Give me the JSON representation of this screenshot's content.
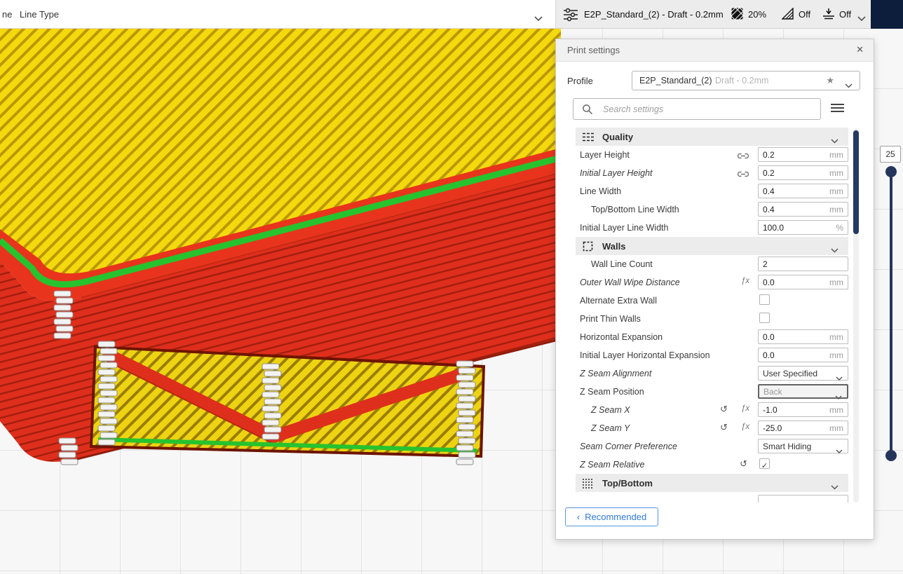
{
  "topbar": {
    "truncated_left_text": "ne",
    "color_scheme_dropdown": {
      "label": "Line Type"
    },
    "print_setup_summary": {
      "profile_text": "E2P_Standard_(2) - Draft - 0.2mm",
      "infill": "20%",
      "support": "Off",
      "adhesion": "Off"
    }
  },
  "print_settings_panel": {
    "title": "Print settings",
    "profile": {
      "label": "Profile",
      "name": "E2P_Standard_(2)",
      "variant": "Draft - 0.2mm"
    },
    "search_placeholder": "Search settings",
    "sections": {
      "quality": "Quality",
      "walls": "Walls",
      "top_bottom": "Top/Bottom"
    },
    "rows": [
      {
        "label": "Layer Height",
        "value": "0.2",
        "unit": "mm"
      },
      {
        "label": "Initial Layer Height",
        "value": "0.2",
        "unit": "mm"
      },
      {
        "label": "Line Width",
        "value": "0.4",
        "unit": "mm"
      },
      {
        "label": "Top/Bottom Line Width",
        "value": "0.4",
        "unit": "mm"
      },
      {
        "label": "Initial Layer Line Width",
        "value": "100.0",
        "unit": "%"
      },
      {
        "label": "Wall Line Count",
        "value": "2",
        "unit": ""
      },
      {
        "label": "Outer Wall Wipe Distance",
        "value": "0.0",
        "unit": "mm"
      },
      {
        "label": "Alternate Extra Wall",
        "value": "",
        "checked": false
      },
      {
        "label": "Print Thin Walls",
        "value": "",
        "checked": false
      },
      {
        "label": "Horizontal Expansion",
        "value": "0.0",
        "unit": "mm"
      },
      {
        "label": "Initial Layer Horizontal Expansion",
        "value": "0.0",
        "unit": "mm"
      },
      {
        "label": "Z Seam Alignment",
        "value": "User Specified"
      },
      {
        "label": "Z Seam Position",
        "value": "Back"
      },
      {
        "label": "Z Seam X",
        "value": "-1.0",
        "unit": "mm"
      },
      {
        "label": "Z Seam Y",
        "value": "-25.0",
        "unit": "mm"
      },
      {
        "label": "Seam Corner Preference",
        "value": "Smart Hiding"
      },
      {
        "label": "Z Seam Relative",
        "checked": true
      }
    ],
    "recommended_button": "Recommended"
  },
  "layer_slider": {
    "current_layer": "25"
  },
  "icons": {
    "close": "✕",
    "star": "★",
    "reset": "↺",
    "fx": "ƒx",
    "check": "✓",
    "back_chevron": "‹"
  },
  "colors": {
    "outer_wall_red": "#e8341c",
    "inner_wall_green": "#27c32e",
    "skin_yellow": "#f4d90e",
    "accent_blue": "#3079d4",
    "slider_navy": "#25355c"
  }
}
